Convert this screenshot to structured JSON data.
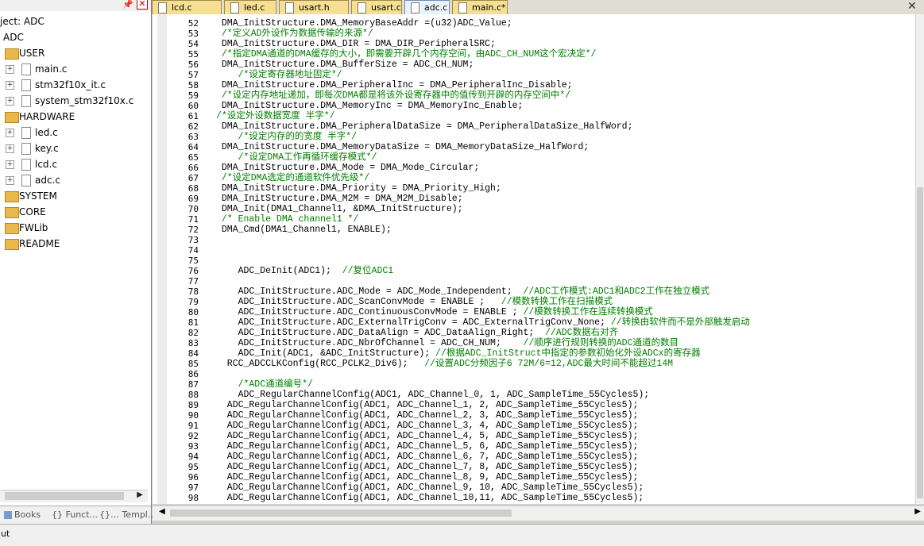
{
  "project_panel": {
    "title": "ject: ADC",
    "root": "ADC",
    "folders": [
      {
        "label": "USER",
        "files": [
          "main.c",
          "stm32f10x_it.c",
          "system_stm32f10x.c"
        ]
      },
      {
        "label": "HARDWARE",
        "files": [
          "led.c",
          "key.c",
          "lcd.c",
          "adc.c"
        ]
      },
      {
        "label": "SYSTEM"
      },
      {
        "label": "CORE"
      },
      {
        "label": "FWLib"
      },
      {
        "label": "README"
      }
    ],
    "bottom_tabs": [
      "Books",
      "{} Funct...",
      "{}… Templ..."
    ]
  },
  "editor_tabs": [
    "lcd.c",
    "led.c",
    "usart.h",
    "usart.c",
    "adc.c",
    "main.c*"
  ],
  "active_tab": "adc.c",
  "code_lines": [
    {
      "n": "52",
      "t": " DMA_InitStructure.DMA_MemoryBaseAddr =(u32)ADC_Value;"
    },
    {
      "n": "53",
      "t": " /*定义AD外设作为数据传输的来源*/"
    },
    {
      "n": "54",
      "t": " DMA_InitStructure.DMA_DIR = DMA_DIR_PeripheralSRC;"
    },
    {
      "n": "55",
      "t": " /*指定DMA通道的DMA缓存的大小，即需要开辟几个内存空间，由ADC_CH_NUM这个宏决定*/"
    },
    {
      "n": "56",
      "t": " DMA_InitStructure.DMA_BufferSize = ADC_CH_NUM;"
    },
    {
      "n": "57",
      "t": "    /*设定寄存器地址固定*/"
    },
    {
      "n": "58",
      "t": " DMA_InitStructure.DMA_PeripheralInc = DMA_PeripheralInc_Disable;"
    },
    {
      "n": "59",
      "t": " /*设定内存地址递加，即每次DMA都是将该外设寄存器中的值传到开辟的内存空间中*/"
    },
    {
      "n": "60",
      "t": " DMA_InitStructure.DMA_MemoryInc = DMA_MemoryInc_Enable;"
    },
    {
      "n": "61",
      "t": "/*设定外设数据宽度 半字*/"
    },
    {
      "n": "62",
      "t": " DMA_InitStructure.DMA_PeripheralDataSize = DMA_PeripheralDataSize_HalfWord;"
    },
    {
      "n": "63",
      "t": "    /*设定内存的的宽度 半字*/"
    },
    {
      "n": "64",
      "t": " DMA_InitStructure.DMA_MemoryDataSize = DMA_MemoryDataSize_HalfWord;"
    },
    {
      "n": "65",
      "t": "    /*设定DMA工作再循环缓存模式*/"
    },
    {
      "n": "66",
      "t": " DMA_InitStructure.DMA_Mode = DMA_Mode_Circular;"
    },
    {
      "n": "67",
      "t": " /*设定DMA选定的通道软件优先级*/"
    },
    {
      "n": "68",
      "t": " DMA_InitStructure.DMA_Priority = DMA_Priority_High;"
    },
    {
      "n": "69",
      "t": " DMA_InitStructure.DMA_M2M = DMA_M2M_Disable;"
    },
    {
      "n": "70",
      "t": " DMA_Init(DMA1_Channel1, &DMA_InitStructure);"
    },
    {
      "n": "71",
      "t": " /* Enable DMA channel1 */"
    },
    {
      "n": "72",
      "t": " DMA_Cmd(DMA1_Channel1, ENABLE);"
    },
    {
      "n": "73",
      "t": ""
    },
    {
      "n": "74",
      "t": ""
    },
    {
      "n": "75",
      "t": ""
    },
    {
      "n": "76",
      "t": "    ADC_DeInit(ADC1);  //复位ADC1"
    },
    {
      "n": "77",
      "t": ""
    },
    {
      "n": "78",
      "t": "    ADC_InitStructure.ADC_Mode = ADC_Mode_Independent;  //ADC工作模式:ADC1和ADC2工作在独立模式"
    },
    {
      "n": "79",
      "t": "    ADC_InitStructure.ADC_ScanConvMode = ENABLE ;   //模数转换工作在扫描模式"
    },
    {
      "n": "80",
      "t": "    ADC_InitStructure.ADC_ContinuousConvMode = ENABLE ; //模数转换工作在连续转换模式"
    },
    {
      "n": "81",
      "t": "    ADC_InitStructure.ADC_ExternalTrigConv = ADC_ExternalTrigConv_None; //转换由软件而不是外部触发启动"
    },
    {
      "n": "82",
      "t": "    ADC_InitStructure.ADC_DataAlign = ADC_DataAlign_Right;  //ADC数据右对齐"
    },
    {
      "n": "83",
      "t": "    ADC_InitStructure.ADC_NbrOfChannel = ADC_CH_NUM;    //顺序进行规则转换的ADC通道的数目"
    },
    {
      "n": "84",
      "t": "    ADC_Init(ADC1, &ADC_InitStructure); //根据ADC_InitStruct中指定的参数初始化外设ADCx的寄存器"
    },
    {
      "n": "85",
      "t": "  RCC_ADCCLKConfig(RCC_PCLK2_Div6);   //设置ADC分频因子6 72M/6=12,ADC最大时间不能超过14M"
    },
    {
      "n": "86",
      "t": ""
    },
    {
      "n": "87",
      "t": "    /*ADC通道编号*/"
    },
    {
      "n": "88",
      "t": "    ADC_RegularChannelConfig(ADC1, ADC_Channel_0, 1, ADC_SampleTime_55Cycles5);"
    },
    {
      "n": "89",
      "t": "  ADC_RegularChannelConfig(ADC1, ADC_Channel_1, 2, ADC_SampleTime_55Cycles5);"
    },
    {
      "n": "90",
      "t": "  ADC_RegularChannelConfig(ADC1, ADC_Channel_2, 3, ADC_SampleTime_55Cycles5);"
    },
    {
      "n": "91",
      "t": "  ADC_RegularChannelConfig(ADC1, ADC_Channel_3, 4, ADC_SampleTime_55Cycles5);"
    },
    {
      "n": "92",
      "t": "  ADC_RegularChannelConfig(ADC1, ADC_Channel_4, 5, ADC_SampleTime_55Cycles5);"
    },
    {
      "n": "93",
      "t": "  ADC_RegularChannelConfig(ADC1, ADC_Channel_5, 6, ADC_SampleTime_55Cycles5);"
    },
    {
      "n": "94",
      "t": "  ADC_RegularChannelConfig(ADC1, ADC_Channel_6, 7, ADC_SampleTime_55Cycles5);"
    },
    {
      "n": "95",
      "t": "  ADC_RegularChannelConfig(ADC1, ADC_Channel_7, 8, ADC_SampleTime_55Cycles5);"
    },
    {
      "n": "96",
      "t": "  ADC_RegularChannelConfig(ADC1, ADC_Channel_8, 9, ADC_SampleTime_55Cycles5);"
    },
    {
      "n": "97",
      "t": "  ADC_RegularChannelConfig(ADC1, ADC_Channel_9, 10, ADC_SampleTime_55Cycles5);"
    },
    {
      "n": "98",
      "t": "  ADC_RegularChannelConfig(ADC1, ADC_Channel_10,11, ADC_SampleTime_55Cycles5);"
    }
  ],
  "status_bar": {
    "text": "ut"
  },
  "colors": {
    "comment": "#008000",
    "number": "#cc0000",
    "keyword": "#5050c0",
    "tab": "#f6df94"
  }
}
